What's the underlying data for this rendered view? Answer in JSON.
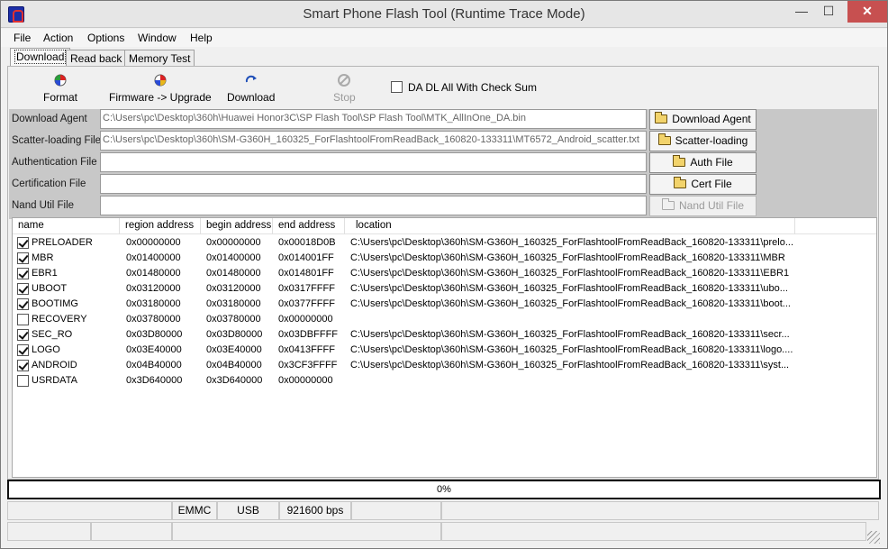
{
  "window": {
    "title": "Smart Phone Flash Tool (Runtime Trace Mode)",
    "minimize": "—",
    "maximize": "☐",
    "close": "✕"
  },
  "menu": [
    "File",
    "Action",
    "Options",
    "Window",
    "Help"
  ],
  "tabs": [
    "Download",
    "Read back",
    "Memory Test"
  ],
  "toolbar": {
    "format": "Format",
    "firmware_upgrade": "Firmware -> Upgrade",
    "download": "Download",
    "stop": "Stop",
    "checksum_label": "DA DL All With Check Sum"
  },
  "files": {
    "download_agent": {
      "label": "Download Agent",
      "value": "C:\\Users\\pc\\Desktop\\360h\\Huawei Honor3C\\SP Flash Tool\\SP Flash Tool\\MTK_AllInOne_DA.bin",
      "button": "Download Agent"
    },
    "scatter": {
      "label": "Scatter-loading File",
      "value": "C:\\Users\\pc\\Desktop\\360h\\SM-G360H_160325_ForFlashtoolFromReadBack_160820-133311\\MT6572_Android_scatter.txt",
      "button": "Scatter-loading"
    },
    "auth": {
      "label": "Authentication File",
      "value": "",
      "button": "Auth File"
    },
    "cert": {
      "label": "Certification File",
      "value": "",
      "button": "Cert File"
    },
    "nand": {
      "label": "Nand Util File",
      "value": "",
      "button": "Nand Util File"
    }
  },
  "table": {
    "headers": [
      "name",
      "region address",
      "begin address",
      "end address",
      "location"
    ],
    "rows": [
      {
        "checked": true,
        "name": "PRELOADER",
        "region": "0x00000000",
        "begin": "0x00000000",
        "end": "0x00018D0B",
        "location": "C:\\Users\\pc\\Desktop\\360h\\SM-G360H_160325_ForFlashtoolFromReadBack_160820-133311\\prelo..."
      },
      {
        "checked": true,
        "name": "MBR",
        "region": "0x01400000",
        "begin": "0x01400000",
        "end": "0x014001FF",
        "location": "C:\\Users\\pc\\Desktop\\360h\\SM-G360H_160325_ForFlashtoolFromReadBack_160820-133311\\MBR"
      },
      {
        "checked": true,
        "name": "EBR1",
        "region": "0x01480000",
        "begin": "0x01480000",
        "end": "0x014801FF",
        "location": "C:\\Users\\pc\\Desktop\\360h\\SM-G360H_160325_ForFlashtoolFromReadBack_160820-133311\\EBR1"
      },
      {
        "checked": true,
        "name": "UBOOT",
        "region": "0x03120000",
        "begin": "0x03120000",
        "end": "0x0317FFFF",
        "location": "C:\\Users\\pc\\Desktop\\360h\\SM-G360H_160325_ForFlashtoolFromReadBack_160820-133311\\ubo..."
      },
      {
        "checked": true,
        "name": "BOOTIMG",
        "region": "0x03180000",
        "begin": "0x03180000",
        "end": "0x0377FFFF",
        "location": "C:\\Users\\pc\\Desktop\\360h\\SM-G360H_160325_ForFlashtoolFromReadBack_160820-133311\\boot..."
      },
      {
        "checked": false,
        "name": "RECOVERY",
        "region": "0x03780000",
        "begin": "0x03780000",
        "end": "0x00000000",
        "location": ""
      },
      {
        "checked": true,
        "name": "SEC_RO",
        "region": "0x03D80000",
        "begin": "0x03D80000",
        "end": "0x03DBFFFF",
        "location": "C:\\Users\\pc\\Desktop\\360h\\SM-G360H_160325_ForFlashtoolFromReadBack_160820-133311\\secr..."
      },
      {
        "checked": true,
        "name": "LOGO",
        "region": "0x03E40000",
        "begin": "0x03E40000",
        "end": "0x0413FFFF",
        "location": "C:\\Users\\pc\\Desktop\\360h\\SM-G360H_160325_ForFlashtoolFromReadBack_160820-133311\\logo...."
      },
      {
        "checked": true,
        "name": "ANDROID",
        "region": "0x04B40000",
        "begin": "0x04B40000",
        "end": "0x3CF3FFFF",
        "location": "C:\\Users\\pc\\Desktop\\360h\\SM-G360H_160325_ForFlashtoolFromReadBack_160820-133311\\syst..."
      },
      {
        "checked": false,
        "name": "USRDATA",
        "region": "0x3D640000",
        "begin": "0x3D640000",
        "end": "0x00000000",
        "location": ""
      }
    ]
  },
  "progress": {
    "text": "0%",
    "fraction": 0
  },
  "status": {
    "storage": "EMMC",
    "port": "USB",
    "baud": "921600 bps"
  },
  "colors": {
    "close_button": "#c75050",
    "titlebar": "#e6e6e6",
    "icon_blue": "#1c2fa8"
  }
}
